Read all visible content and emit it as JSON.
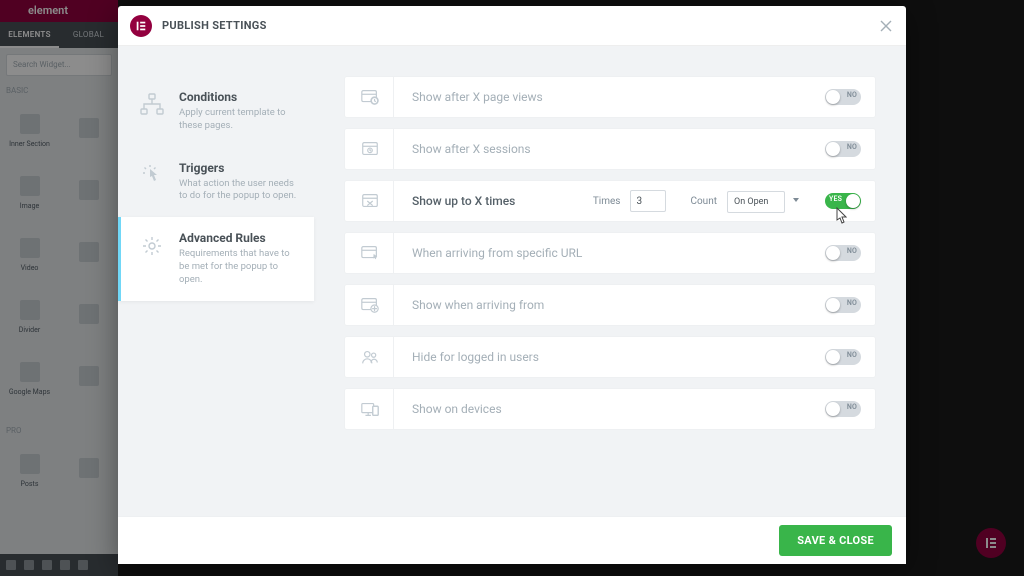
{
  "bg": {
    "brand": "element",
    "tab_elements": "ELEMENTS",
    "tab_global": "GLOBAL",
    "search_placeholder": "Search Widget...",
    "group_basic": "BASIC",
    "group_pro": "PRO",
    "widgets_basic": [
      "Inner Section",
      "",
      "Image",
      "",
      "Video",
      "",
      "Divider",
      "",
      "Google Maps",
      ""
    ],
    "widgets_pro": [
      "Posts",
      ""
    ]
  },
  "modal": {
    "title": "PUBLISH SETTINGS",
    "close": "×"
  },
  "side": {
    "items": [
      {
        "title": "Conditions",
        "desc": "Apply current template to these pages."
      },
      {
        "title": "Triggers",
        "desc": "What action the user needs to do for the popup to open."
      },
      {
        "title": "Advanced Rules",
        "desc": "Requirements that have to be met for the popup to open."
      }
    ],
    "active_index": 2
  },
  "rules": [
    {
      "label": "Show after X page views",
      "on": false
    },
    {
      "label": "Show after X sessions",
      "on": false
    },
    {
      "label": "Show up to X times",
      "on": true,
      "times_label": "Times",
      "times_value": "3",
      "count_label": "Count",
      "count_value": "On Open"
    },
    {
      "label": "When arriving from specific URL",
      "on": false
    },
    {
      "label": "Show when arriving from",
      "on": false
    },
    {
      "label": "Hide for logged in users",
      "on": false
    },
    {
      "label": "Show on devices",
      "on": false
    }
  ],
  "toggle_labels": {
    "on": "YES",
    "off": "NO"
  },
  "footer": {
    "save": "SAVE & CLOSE"
  }
}
